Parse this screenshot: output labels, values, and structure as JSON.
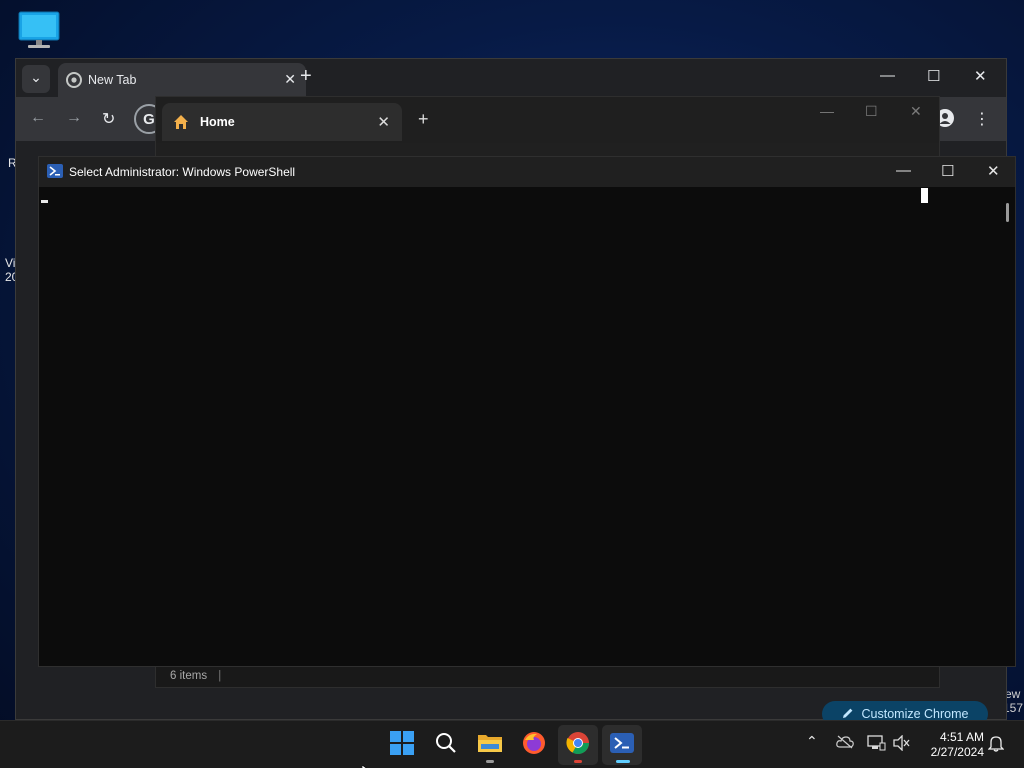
{
  "desktop": {
    "icon": "this-pc-icon",
    "left_fragment_1": "R",
    "left_fragment_2": "Vi",
    "left_fragment_3": "20",
    "right_fragment_1": "ew",
    "right_fragment_2": "157"
  },
  "chrome_back": {
    "tab_title": "New Tab",
    "customize_label": "Customize Chrome",
    "omnibox_fragment": "G",
    "colors": {
      "frame": "#202124",
      "toolbar": "#35363a",
      "customize_bg": "#0b4366"
    }
  },
  "explorer": {
    "tab_title": "Home",
    "status_text": "6 items",
    "status_separator": "|"
  },
  "powershell": {
    "title": "Select Administrator: Windows PowerShell",
    "colors": {
      "console_bg": "#0c0c0c",
      "titlebar": "#202020"
    }
  },
  "glyphs": {
    "minimize": "—",
    "maximize": "☐",
    "close": "✕",
    "plus": "+",
    "back": "←",
    "forward": "→",
    "reload": "↻",
    "menu": "⋮",
    "chevron_down": "⌄",
    "chevron_up": "⌃"
  },
  "taskbar": {
    "apps": [
      "start",
      "search",
      "file-explorer",
      "firefox",
      "chrome",
      "powershell"
    ],
    "clock_time": "4:51 AM",
    "clock_date": "2/27/2024",
    "colors": {
      "accent": "#60cdff",
      "bg": "#1c1c1c"
    }
  }
}
